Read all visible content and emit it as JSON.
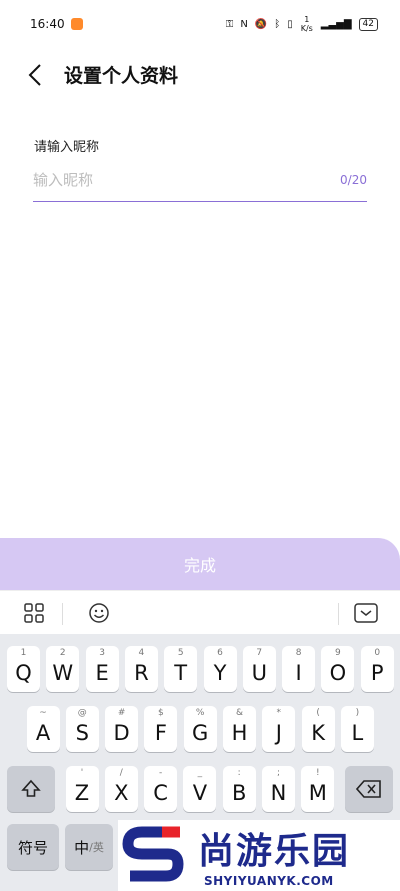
{
  "status_bar": {
    "time": "16:40",
    "speed": "1 K/s",
    "battery": "42"
  },
  "header": {
    "title": "设置个人资料"
  },
  "form": {
    "nickname_label": "请输入昵称",
    "nickname_placeholder": "输入昵称",
    "nickname_value": "",
    "counter": "0/20"
  },
  "done_button": {
    "label": "完成"
  },
  "keyboard": {
    "row1": [
      {
        "key": "Q",
        "sub": "1"
      },
      {
        "key": "W",
        "sub": "2"
      },
      {
        "key": "E",
        "sub": "3"
      },
      {
        "key": "R",
        "sub": "4"
      },
      {
        "key": "T",
        "sub": "5"
      },
      {
        "key": "Y",
        "sub": "6"
      },
      {
        "key": "U",
        "sub": "7"
      },
      {
        "key": "I",
        "sub": "8"
      },
      {
        "key": "O",
        "sub": "9"
      },
      {
        "key": "P",
        "sub": "0"
      }
    ],
    "row2": [
      {
        "key": "A",
        "sub": "~"
      },
      {
        "key": "S",
        "sub": "@"
      },
      {
        "key": "D",
        "sub": "#"
      },
      {
        "key": "F",
        "sub": "$"
      },
      {
        "key": "G",
        "sub": "%"
      },
      {
        "key": "H",
        "sub": "&"
      },
      {
        "key": "J",
        "sub": "*"
      },
      {
        "key": "K",
        "sub": "("
      },
      {
        "key": "L",
        "sub": ")"
      }
    ],
    "row3": [
      {
        "key": "Z",
        "sub": "'"
      },
      {
        "key": "X",
        "sub": "/"
      },
      {
        "key": "C",
        "sub": "-"
      },
      {
        "key": "V",
        "sub": "_"
      },
      {
        "key": "B",
        "sub": ":"
      },
      {
        "key": "N",
        "sub": ";"
      },
      {
        "key": "M",
        "sub": "!"
      }
    ],
    "symbols_label": "符号",
    "lang_main": "中",
    "lang_sub": "/英"
  },
  "watermark": {
    "text": "尚游乐园",
    "url": "SHYIYUANYK.COM",
    "letter": "S"
  }
}
